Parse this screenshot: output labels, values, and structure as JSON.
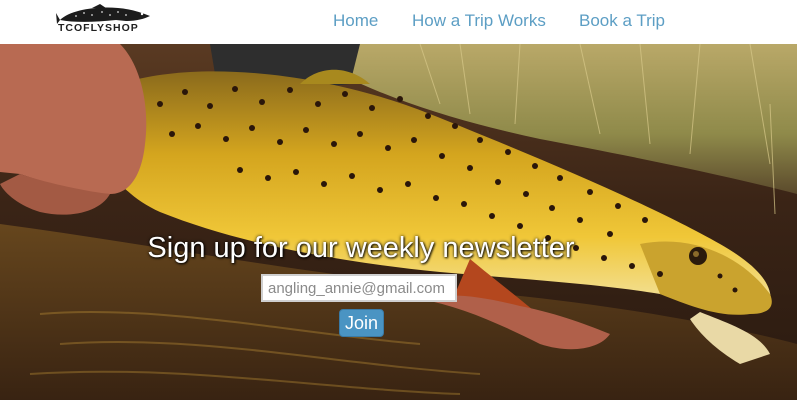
{
  "brand": {
    "logo_text": "TCOFLYSHOP"
  },
  "nav": {
    "items": [
      {
        "label": "Home"
      },
      {
        "label": "How a Trip Works"
      },
      {
        "label": "Book a Trip"
      }
    ]
  },
  "hero": {
    "headline": "Sign up for our weekly newsletter",
    "email_field": {
      "value": "",
      "placeholder": "angling_annie@gmail.com"
    },
    "join_label": "Join"
  },
  "colors": {
    "nav_link": "#5c9ec4",
    "button": "#4a94c3",
    "headline": "#ffffff"
  }
}
